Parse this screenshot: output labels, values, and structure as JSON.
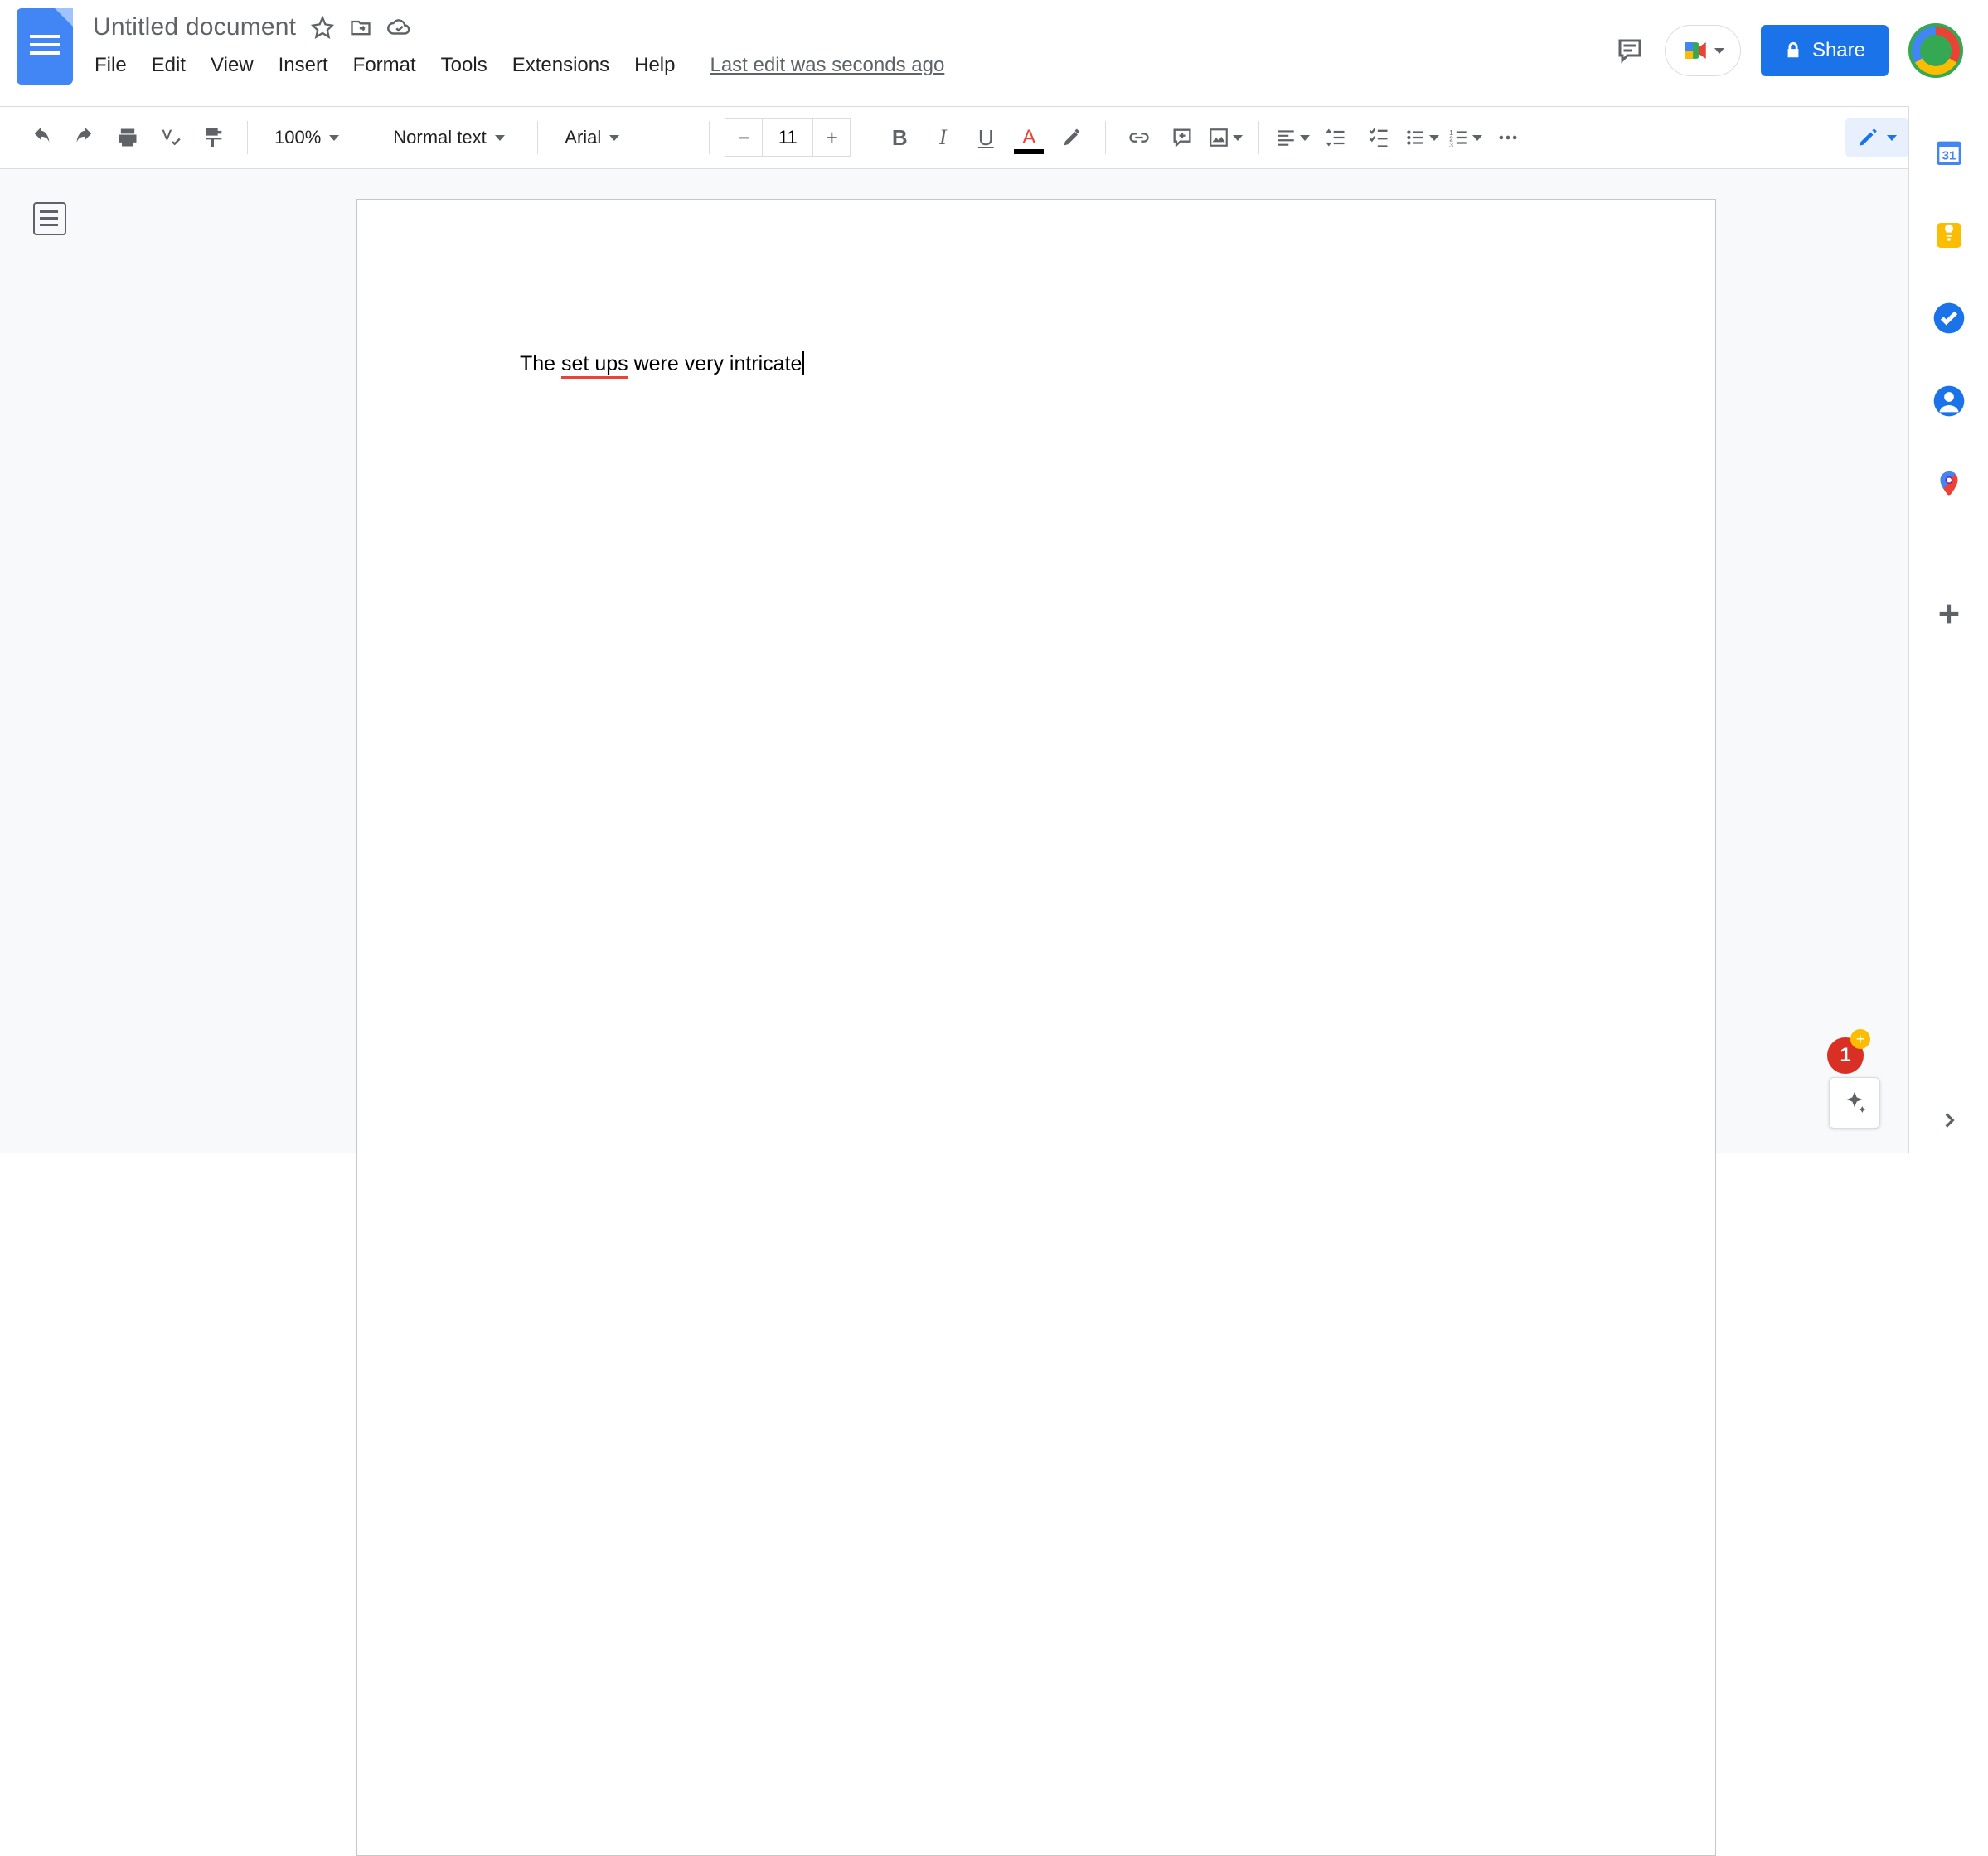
{
  "header": {
    "doc_title": "Untitled document",
    "last_edit": "Last edit was seconds ago",
    "share_label": "Share"
  },
  "menus": {
    "file": "File",
    "edit": "Edit",
    "view": "View",
    "insert": "Insert",
    "format": "Format",
    "tools": "Tools",
    "extensions": "Extensions",
    "help": "Help"
  },
  "toolbar": {
    "zoom": "100%",
    "style": "Normal text",
    "font": "Arial",
    "font_size": "11"
  },
  "document": {
    "text_before": "The ",
    "spell_error": "set ups",
    "text_after": " were very intricate"
  },
  "notifications": {
    "count": "1",
    "plus": "+"
  },
  "side_panel": {
    "calendar_day": "31"
  }
}
